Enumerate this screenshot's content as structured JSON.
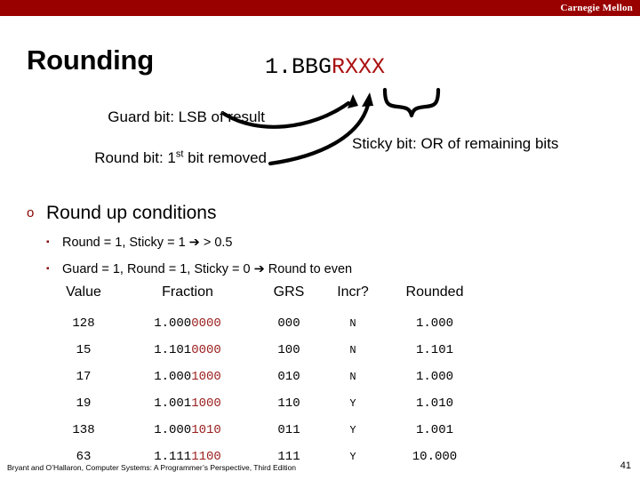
{
  "banner": {
    "brand": "Carnegie Mellon",
    "color": "#990000"
  },
  "title": "Rounding",
  "formula": {
    "black_part": "1.BBG",
    "red_part": "RXXX",
    "red_color": "#aa1111"
  },
  "callouts": {
    "guard": "Guard bit: LSB of result",
    "round_prefix": "Round bit: 1",
    "round_sup": "st",
    "round_suffix": " bit removed",
    "sticky": "Sticky bit: OR of remaining bits"
  },
  "bullets": {
    "level1": "Round up conditions",
    "level1_marker": "o",
    "level2_marker": "▪",
    "level2": [
      "Round = 1, Sticky = 1  ➔  > 0.5",
      "Guard = 1, Round = 1, Sticky = 0  ➔  Round to even"
    ]
  },
  "table": {
    "headers": [
      "Value",
      "Fraction",
      "GRS",
      "Incr?",
      "Rounded"
    ],
    "rows": [
      {
        "value": "128",
        "frac_black": "1.000",
        "frac_red": "0000",
        "grs": "000",
        "incr": "N",
        "rounded": "1.000"
      },
      {
        "value": "15",
        "frac_black": "1.101",
        "frac_red": "0000",
        "grs": "100",
        "incr": "N",
        "rounded": "1.101"
      },
      {
        "value": "17",
        "frac_black": "1.000",
        "frac_red": "1000",
        "grs": "010",
        "incr": "N",
        "rounded": "1.000"
      },
      {
        "value": "19",
        "frac_black": "1.001",
        "frac_red": "1000",
        "grs": "110",
        "incr": "Y",
        "rounded": "1.010"
      },
      {
        "value": "138",
        "frac_black": "1.000",
        "frac_red": "1010",
        "grs": "011",
        "incr": "Y",
        "rounded": "1.001"
      },
      {
        "value": "63",
        "frac_black": "1.111",
        "frac_red": "1100",
        "grs": "111",
        "incr": "Y",
        "rounded": "10.000"
      }
    ]
  },
  "footer": {
    "citation": "Bryant and O’Hallaron, Computer Systems: A Programmer’s Perspective, Third Edition",
    "page": "41"
  }
}
